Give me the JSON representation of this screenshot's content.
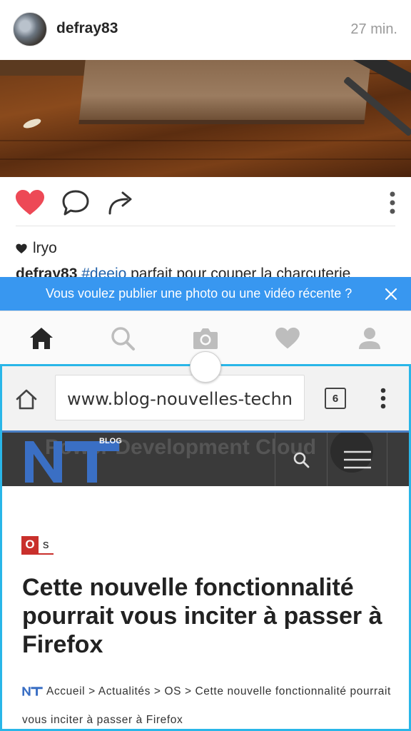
{
  "instagram": {
    "post": {
      "username": "defray83",
      "time": "27 min.",
      "likes_user": "lryo",
      "caption_user": "defray83",
      "caption_tag": "#deejo",
      "caption_text": " parfait pour couper la charcuterie"
    },
    "banner": {
      "text": "Vous voulez publier une photo ou une vidéo récente ?"
    },
    "colors": {
      "like": "#ed4956",
      "banner": "#3897f0"
    },
    "tabs": [
      "home-icon",
      "search-icon",
      "camera-icon",
      "heart-icon",
      "profile-icon"
    ]
  },
  "browser": {
    "url": "www.blog-nouvelles-techn",
    "tab_count": "6",
    "site": {
      "logo_letters": "NT",
      "logo_tag": "BLOG",
      "ghost_text": "Power Development Cloud"
    },
    "article": {
      "category_letter": "O",
      "category_label": "s",
      "headline": "Cette nouvelle fonctionnalité pourrait vous inciter à passer à Firefox",
      "breadcrumb": "Accueil > Actualités > OS > Cette nouvelle fonctionnalité pourrait vous inciter à passer à Firefox"
    },
    "colors": {
      "border": "#29b6e8",
      "header": "#3a3a3a",
      "logo": "#3a6fc4",
      "category": "#c9302c"
    }
  }
}
